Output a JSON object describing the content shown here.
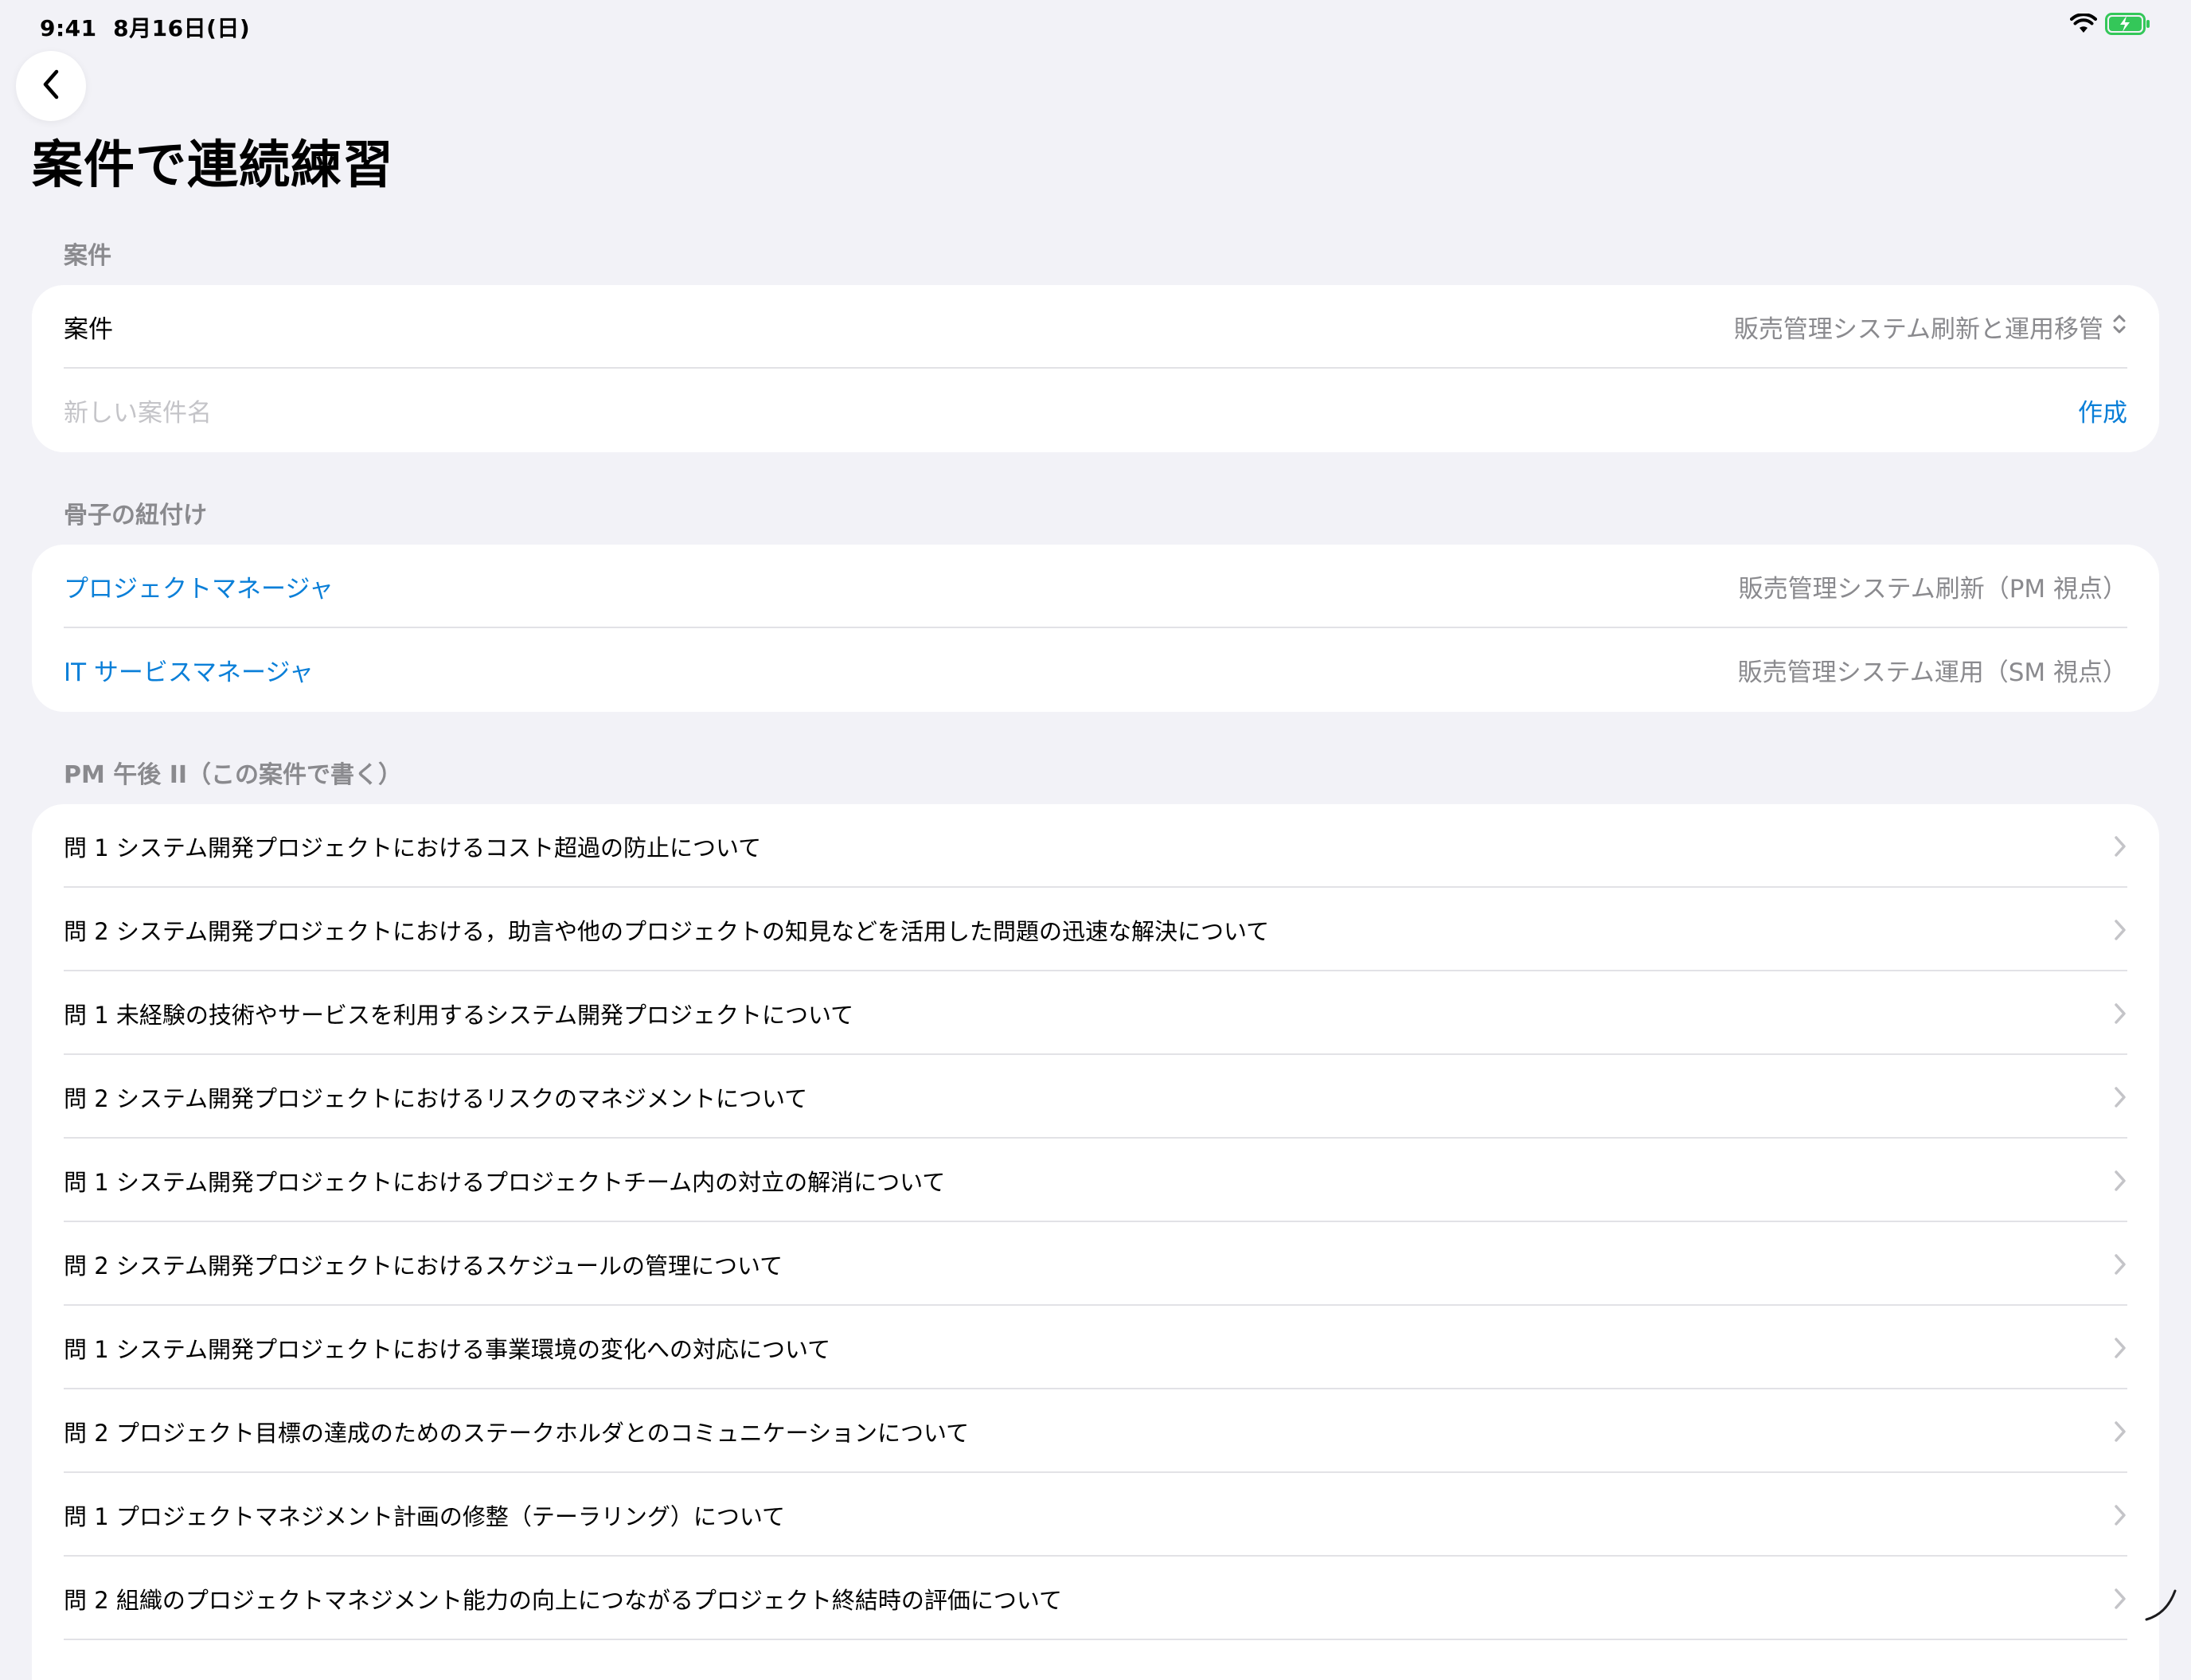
{
  "status_bar": {
    "time": "9:41",
    "date": "8月16日(日)",
    "icons": [
      "wifi-icon",
      "battery-charging-icon"
    ],
    "battery_color": "#34c759"
  },
  "nav": {
    "back_icon": "chevron-left-icon"
  },
  "page": {
    "title": "案件で連続練習"
  },
  "case_section": {
    "header": "案件",
    "picker_label": "案件",
    "picker_value": "販売管理システム刷新と運用移管",
    "new_name_placeholder": "新しい案件名",
    "create_label": "作成"
  },
  "skeleton_section": {
    "header": "骨子の紐付け",
    "items": [
      {
        "label": "プロジェクトマネージャ",
        "value": "販売管理システム刷新（PM 視点）"
      },
      {
        "label": "IT サービスマネージャ",
        "value": "販売管理システム運用（SM 視点）"
      }
    ]
  },
  "pm_section": {
    "header": "PM 午後 II（この案件で書く）",
    "items": [
      "問 1 システム開発プロジェクトにおけるコスト超過の防止について",
      "問 2 システム開発プロジェクトにおける，助言や他のプロジェクトの知見などを活用した問題の迅速な解決について",
      "問 1 未経験の技術やサービスを利用するシステム開発プロジェクトについて",
      "問 2 システム開発プロジェクトにおけるリスクのマネジメントについて",
      "問 1 システム開発プロジェクトにおけるプロジェクトチーム内の対立の解消について",
      "問 2 システム開発プロジェクトにおけるスケジュールの管理について",
      "問 1 システム開発プロジェクトにおける事業環境の変化への対応について",
      "問 2 プロジェクト目標の達成のためのステークホルダとのコミュニケーションについて",
      "問 1 プロジェクトマネジメント計画の修整（テーラリング）について",
      "問 2 組織のプロジェクトマネジメント能力の向上につながるプロジェクト終結時の評価について"
    ]
  },
  "colors": {
    "accent": "#0a7fd8",
    "background": "#f2f2f7",
    "secondary_text": "#8a8a8e"
  }
}
